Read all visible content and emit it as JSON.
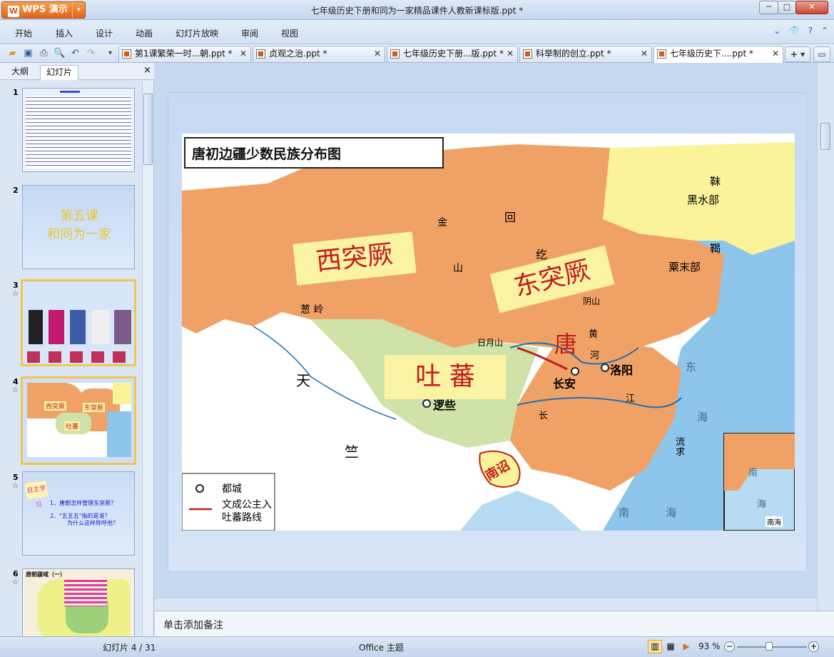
{
  "app": {
    "name": "WPS 演示",
    "window_title": "七年级历史下册和同为一家精品课件人教新课标版.ppt *"
  },
  "menu": [
    "开始",
    "插入",
    "设计",
    "动画",
    "幻灯片放映",
    "审阅",
    "视图"
  ],
  "doc_tabs": [
    {
      "label": "第1课繁荣一时...朝.ppt *"
    },
    {
      "label": "贞观之治.ppt *"
    },
    {
      "label": "七年级历史下册...版.ppt *"
    },
    {
      "label": "科举制的创立.ppt *"
    },
    {
      "label": "七年级历史下....ppt *"
    }
  ],
  "panel": {
    "tab_outline": "大纲",
    "tab_slides": "幻灯片",
    "close": "×"
  },
  "thumbs": [
    {
      "num": "1"
    },
    {
      "num": "2",
      "title": "第五课\n和同为一家"
    },
    {
      "num": "3"
    },
    {
      "num": "4",
      "labels": [
        "西突厥",
        "东突厥",
        "吐蕃"
      ]
    },
    {
      "num": "5",
      "badge": "自主学习",
      "lines": [
        "1、唐朝怎样管理东突厥？",
        "2、\"五五五\"指的是谁？",
        "为什么这样称呼他？"
      ]
    },
    {
      "num": "6",
      "title": "唐朝疆域（一）"
    }
  ],
  "map": {
    "title": "唐初边疆少数民族分布图",
    "labels": {
      "west_turks": "西突厥",
      "east_turks": "东突厥",
      "tubo": "吐  蕃",
      "tang": "唐",
      "nanzhao": "南诏",
      "mohe": "靺",
      "heishui": "黑水部",
      "he": "鞨",
      "sumo": "粟末部",
      "tian": "天",
      "zhu": "竺",
      "changan": "长安",
      "luoyang": "洛阳",
      "luoxie": "逻些",
      "riyue": "日月山",
      "congling": "葱  岭",
      "jin": "金",
      "shan": "山",
      "hui": "回",
      "he2": "纥",
      "yinshan": "阴山",
      "huang": "黄",
      "river": "河",
      "jiang": "江",
      "chang": "长",
      "east": "东",
      "sea": "海",
      "south": "南",
      "sea2": "海",
      "liuqiu": "流求",
      "nan_small": "南",
      "hai_small": "海",
      "nanhai_box": "南海"
    },
    "legend": {
      "capital": "都城",
      "route_line1": "文成公主入",
      "route_line2": "吐蕃路线"
    }
  },
  "notes_placeholder": "单击添加备注",
  "status": {
    "slide_counter": "幻灯片 4 / 31",
    "theme": "Office 主题",
    "zoom": "93 %"
  }
}
